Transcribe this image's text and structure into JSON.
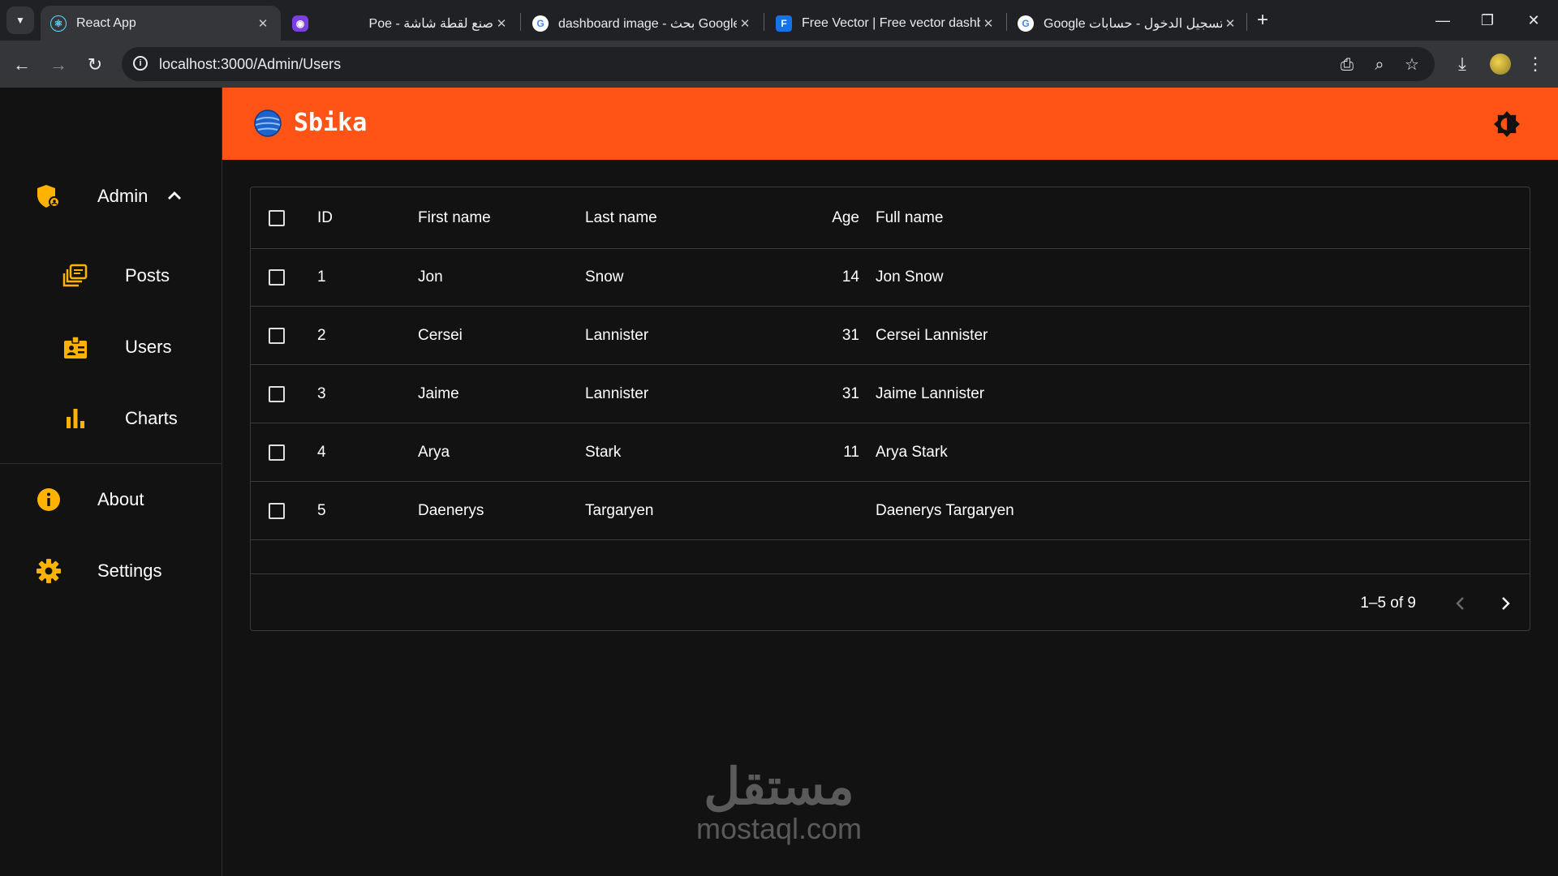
{
  "browser": {
    "tabs": [
      {
        "title": "React App",
        "active": true
      },
      {
        "title": "Poe - صنع لقطة شاشة",
        "active": false
      },
      {
        "title": "dashboard image - بحث Google",
        "active": false
      },
      {
        "title": "Free Vector | Free vector dashbo",
        "active": false
      },
      {
        "title": "Google تسجيل الدخول - حسابات",
        "active": false
      }
    ],
    "url": "localhost:3000/Admin/Users"
  },
  "app": {
    "brand": "Sbika",
    "colors": {
      "accent": "#ff5416",
      "icon": "#ffb300",
      "background": "#121212"
    }
  },
  "sidebar": {
    "admin": {
      "label": "Admin",
      "icon": "admin-shield-icon",
      "expanded": true
    },
    "sub_items": [
      {
        "label": "Posts",
        "icon": "posts-icon"
      },
      {
        "label": "Users",
        "icon": "users-badge-icon"
      },
      {
        "label": "Charts",
        "icon": "bar-chart-icon"
      }
    ],
    "items": [
      {
        "label": "About",
        "icon": "info-icon"
      },
      {
        "label": "Settings",
        "icon": "gear-icon"
      }
    ]
  },
  "table": {
    "columns": {
      "id": "ID",
      "first_name": "First name",
      "last_name": "Last name",
      "age": "Age",
      "full_name": "Full name"
    },
    "rows": [
      {
        "id": "1",
        "first_name": "Jon",
        "last_name": "Snow",
        "age": "14",
        "full_name": "Jon Snow"
      },
      {
        "id": "2",
        "first_name": "Cersei",
        "last_name": "Lannister",
        "age": "31",
        "full_name": "Cersei Lannister"
      },
      {
        "id": "3",
        "first_name": "Jaime",
        "last_name": "Lannister",
        "age": "31",
        "full_name": "Jaime Lannister"
      },
      {
        "id": "4",
        "first_name": "Arya",
        "last_name": "Stark",
        "age": "11",
        "full_name": "Arya Stark"
      },
      {
        "id": "5",
        "first_name": "Daenerys",
        "last_name": "Targaryen",
        "age": "",
        "full_name": "Daenerys Targaryen"
      }
    ],
    "pagination": "1–5 of 9"
  },
  "watermark": {
    "arabic": "مستقل",
    "latin": "mostaql.com"
  }
}
